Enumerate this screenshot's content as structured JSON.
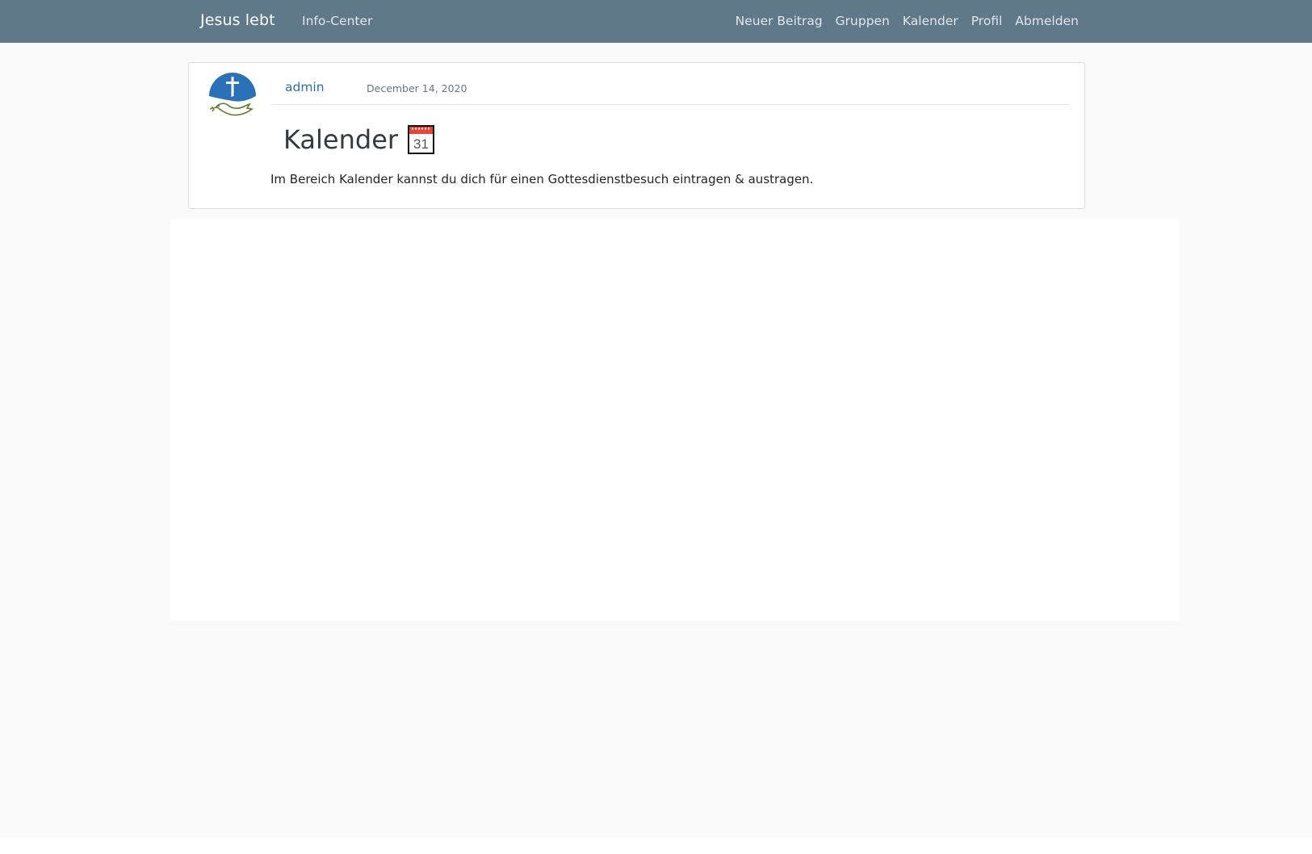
{
  "navbar": {
    "brand": "Jesus lebt",
    "info_center": "Info-Center",
    "right_items": [
      "Neuer Beitrag",
      "Gruppen",
      "Kalender",
      "Profil",
      "Abmelden"
    ]
  },
  "post": {
    "author": "admin",
    "date": "December 14, 2020",
    "title": "Kalender",
    "title_icon": "calendar-icon",
    "calendar_day": "31",
    "body": "Im Bereich Kalender kannst du dich für einen Gottesdienstbesuch eintragen & austragen.",
    "avatar_icon": "cross-dove-logo"
  },
  "colors": {
    "navbar_bg": "#5f788a",
    "page_bg": "#fafafa",
    "link": "#2f6ea8",
    "avatar_blue": "#2b71b8",
    "dove_green": "#5f7a2e"
  }
}
